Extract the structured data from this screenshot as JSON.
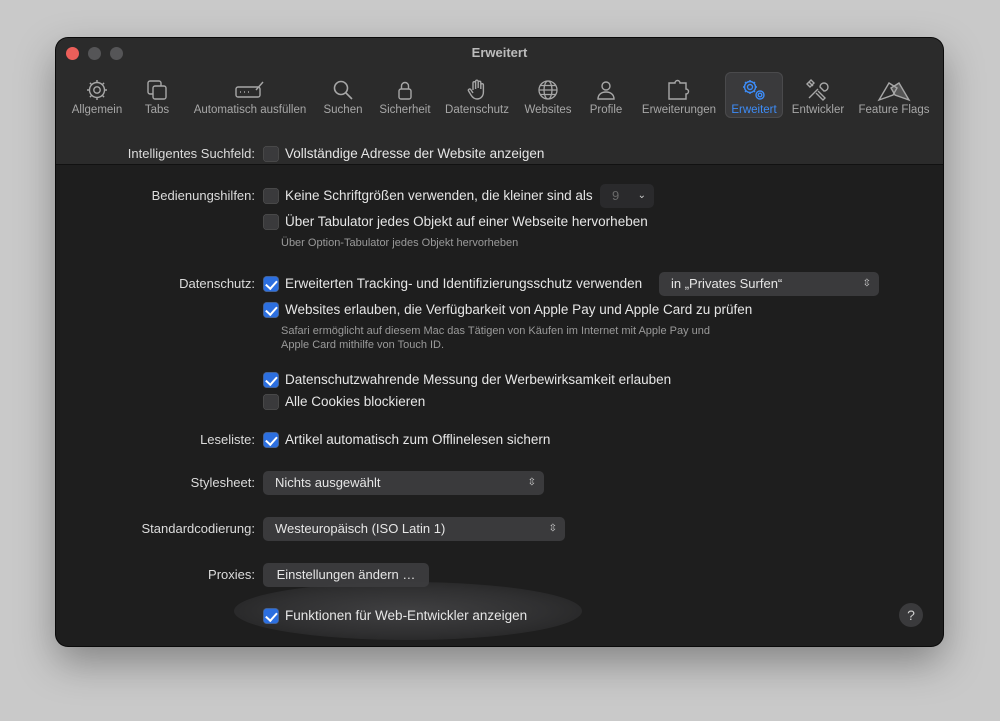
{
  "window": {
    "title": "Erweitert"
  },
  "toolbar": {
    "tabs": [
      {
        "label": "Allgemein",
        "icon": "gear-icon"
      },
      {
        "label": "Tabs",
        "icon": "tabs-icon"
      },
      {
        "label": "Automatisch ausfüllen",
        "icon": "autofill-icon"
      },
      {
        "label": "Suchen",
        "icon": "search-icon"
      },
      {
        "label": "Sicherheit",
        "icon": "lock-icon"
      },
      {
        "label": "Datenschutz",
        "icon": "hand-icon"
      },
      {
        "label": "Websites",
        "icon": "globe-icon"
      },
      {
        "label": "Profile",
        "icon": "person-icon"
      },
      {
        "label": "Erweiterungen",
        "icon": "puzzle-icon"
      },
      {
        "label": "Erweitert",
        "icon": "gears-icon",
        "active": true
      },
      {
        "label": "Entwickler",
        "icon": "tools-icon"
      },
      {
        "label": "Feature Flags",
        "icon": "flags-icon"
      }
    ]
  },
  "settings": {
    "smart_search": {
      "label": "Intelligentes Suchfeld:",
      "full_address": {
        "text": "Vollständige Adresse der Website anzeigen",
        "checked": false
      }
    },
    "accessibility": {
      "label": "Bedienungshilfen:",
      "min_font": {
        "text": "Keine Schriftgrößen verwenden, die kleiner sind als",
        "checked": false,
        "value": "9"
      },
      "tab_highlight": {
        "text": "Über Tabulator jedes Objekt auf einer Webseite hervorheben",
        "checked": false
      },
      "tab_hint": "Über Option-Tabulator jedes Objekt hervorheben"
    },
    "privacy": {
      "label": "Datenschutz:",
      "tracking": {
        "text": "Erweiterten Tracking- und Identifizierungsschutz verwenden",
        "checked": true,
        "option": "in „Privates Surfen“"
      },
      "apple_pay": {
        "text": "Websites erlauben, die Verfügbarkeit von Apple Pay und Apple Card zu prüfen",
        "checked": true
      },
      "apple_pay_hint_1": "Safari ermöglicht auf diesem Mac das Tätigen von Käufen im Internet mit Apple Pay und",
      "apple_pay_hint_2": "Apple Card mithilfe von Touch ID.",
      "ad_measurement": {
        "text": "Datenschutzwahrende Messung der Werbewirksamkeit erlauben",
        "checked": true
      },
      "block_cookies": {
        "text": "Alle Cookies blockieren",
        "checked": false
      }
    },
    "reading_list": {
      "label": "Leseliste:",
      "offline": {
        "text": "Artikel automatisch zum Offlinelesen sichern",
        "checked": true
      }
    },
    "stylesheet": {
      "label": "Stylesheet:",
      "value": "Nichts ausgewählt"
    },
    "encoding": {
      "label": "Standardcodierung:",
      "value": "Westeuropäisch (ISO Latin 1)"
    },
    "proxies": {
      "label": "Proxies:",
      "button": "Einstellungen ändern …"
    },
    "web_dev": {
      "text": "Funktionen für Web-Entwickler anzeigen",
      "checked": true
    }
  },
  "help": {
    "label": "?"
  },
  "colors": {
    "accent": "#3d8cf7",
    "checkbox_on": "#2c6fe0",
    "background": "#1e1e1e"
  }
}
